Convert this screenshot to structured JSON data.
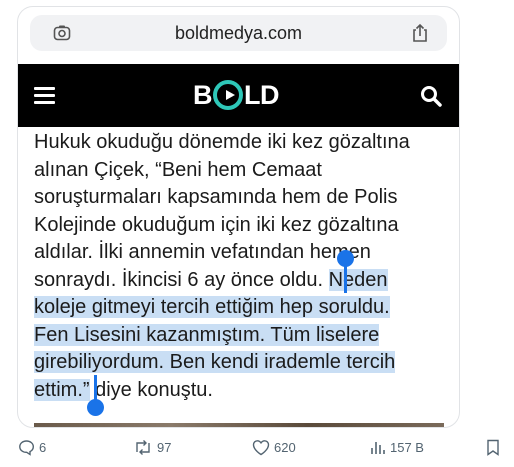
{
  "browser": {
    "url": "boldmedya.com"
  },
  "site": {
    "logo_text_left": "B",
    "logo_text_right": "LD"
  },
  "article": {
    "line1": "Hukuk okuduğu dönemde iki kez gözaltına",
    "line2": "alınan Çiçek, “Beni hem Cemaat",
    "line3": "soruşturmaları kapsamında hem de Polis",
    "line4": "Kolejinde okuduğum için iki kez gözaltına",
    "line5": "aldılar. İlki annemin vefatından hemen",
    "line6_plain": "sonraydı. İkincisi 6 ay önce oldu. ",
    "line6_sel": "Neden",
    "line7": "koleje gitmeyi tercih ettiğim hep soruldu.",
    "line8": "Fen Lisesini kazanmıştım. Tüm liselere",
    "line9": "girebiliyordum. Ben kendi irademle tercih",
    "line10_sel": "ettim.”",
    "line10_plain": " diye konuştu."
  },
  "actions": {
    "replies": "6",
    "reposts": "97",
    "likes": "620",
    "views": "157 B"
  },
  "colors": {
    "selection": "#c9def4",
    "handle": "#1a73e8",
    "logo_accent": "#2ec7b8"
  }
}
